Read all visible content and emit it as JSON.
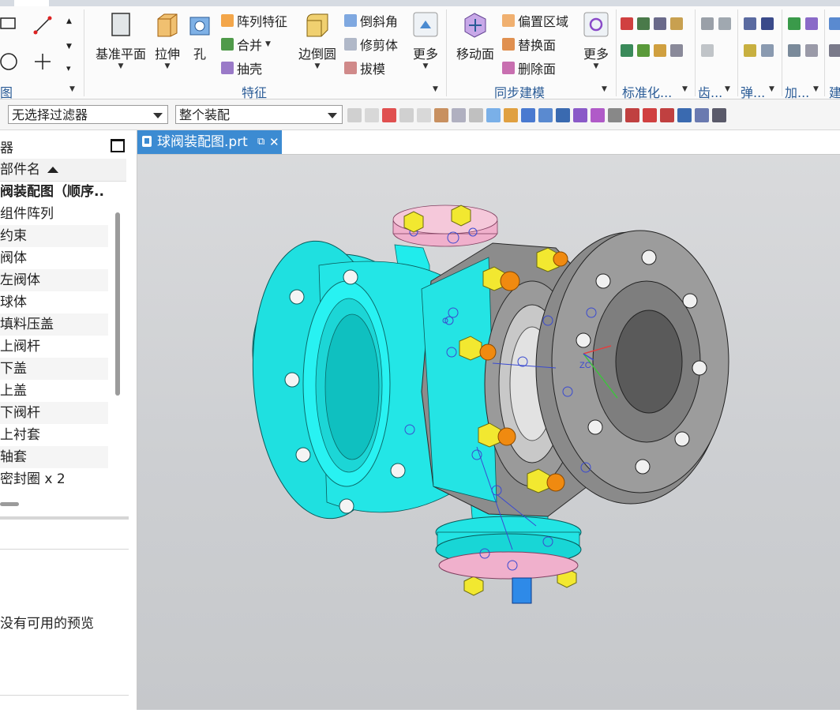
{
  "ribbon": {
    "groups": [
      {
        "label": "图"
      },
      {
        "label": "特征"
      },
      {
        "label": "同步建模"
      },
      {
        "label": "标准化..."
      },
      {
        "label": "齿..."
      },
      {
        "label": "弹..."
      },
      {
        "label": "加..."
      },
      {
        "label": "建"
      }
    ],
    "feature_buttons": {
      "datum_plane": "基准平面",
      "extrude": "拉伸",
      "hole": "孔",
      "pattern_feature": "阵列特征",
      "unite": "合并",
      "shell": "抽壳",
      "edge_blend": "边倒圆",
      "chamfer": "倒斜角",
      "trim_body": "修剪体",
      "draft": "拔模",
      "more": "更多"
    },
    "sync_buttons": {
      "move_face": "移动面",
      "offset_region": "偏置区域",
      "replace_face": "替换面",
      "delete_face": "删除面",
      "more": "更多"
    }
  },
  "toolbar": {
    "selection_filter": "无选择过滤器",
    "scope": "整个装配"
  },
  "navigator": {
    "title": "器",
    "column_header": "部件名",
    "items": [
      "阀装配图（顺序..",
      "组件阵列",
      "约束",
      "阀体",
      "左阀体",
      "球体",
      "填料压盖",
      "上阀杆",
      "下盖",
      "上盖",
      "下阀杆",
      "上衬套",
      "轴套",
      "密封圈 x 2"
    ],
    "preview_text": "没有可用的预览"
  },
  "document": {
    "tab_label": "球阀装配图.prt",
    "triad_label": "ZC"
  },
  "colors": {
    "accent": "#3c8bd2",
    "cyan_body": "#21f0f0",
    "gray_body": "#8a8a8a",
    "bolt_yellow": "#f2e830",
    "nut_orange": "#f08a10",
    "pink_cap": "#f2b8d2"
  }
}
